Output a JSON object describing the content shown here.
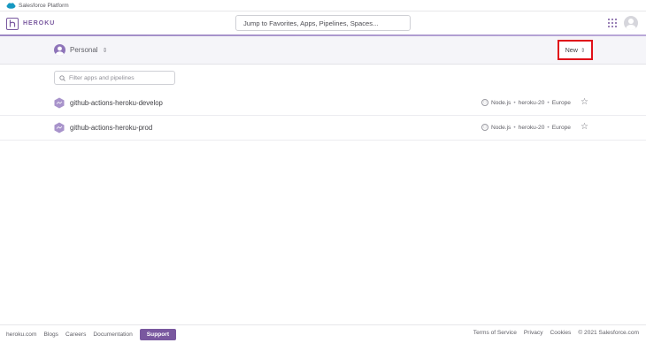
{
  "platform_bar": {
    "label": "Salesforce Platform"
  },
  "header": {
    "brand": "HEROKU",
    "search_placeholder": "Jump to Favorites, Apps, Pipelines, Spaces...",
    "apps_icon": "grid-icon",
    "avatar_icon": "user-avatar-icon"
  },
  "subheader": {
    "account_label": "Personal",
    "new_button_label": "New"
  },
  "filter": {
    "placeholder": "Filter apps and pipelines"
  },
  "apps": [
    {
      "name": "github-actions-heroku-develop",
      "runtime": "Node.js",
      "stack": "heroku-20",
      "region": "Europe"
    },
    {
      "name": "github-actions-heroku-prod",
      "runtime": "Node.js",
      "stack": "heroku-20",
      "region": "Europe"
    }
  ],
  "footer": {
    "links_left": [
      "heroku.com",
      "Blogs",
      "Careers",
      "Documentation"
    ],
    "support_label": "Support",
    "links_right": [
      "Terms of Service",
      "Privacy",
      "Cookies",
      "© 2021 Salesforce.com"
    ]
  },
  "colors": {
    "brand_purple": "#79589f",
    "highlight_red": "#e0101a"
  }
}
